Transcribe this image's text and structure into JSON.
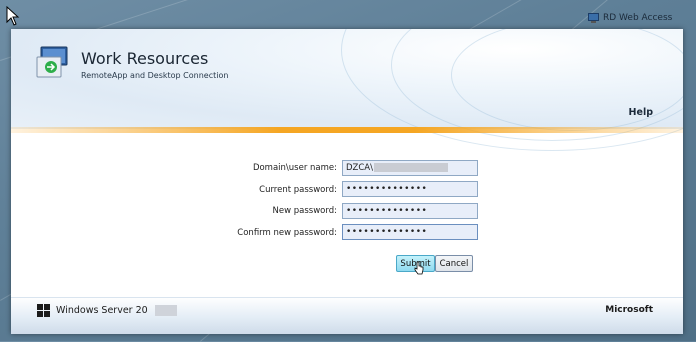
{
  "top_bar": {
    "label": "RD Web Access",
    "icon": "rd-web-access-icon"
  },
  "header": {
    "title": "Work Resources",
    "subtitle": "RemoteApp and Desktop Connection",
    "help_label": "Help",
    "logo_icon": "remoteapp-monitor-icon",
    "accent_color": "#f5a623"
  },
  "form": {
    "fields": [
      {
        "label": "Domain\\user name:",
        "value": "DZCA\\"
      },
      {
        "label": "Current password:",
        "value": "••••••••••••••"
      },
      {
        "label": "New password:",
        "value": "••••••••••••••"
      },
      {
        "label": "Confirm new password:",
        "value": "••••••••••••••"
      }
    ],
    "submit_label": "Submit",
    "cancel_label": "Cancel"
  },
  "footer": {
    "product": "Windows Server 20",
    "vendor": "Microsoft",
    "logo_icon": "windows-logo-icon"
  }
}
